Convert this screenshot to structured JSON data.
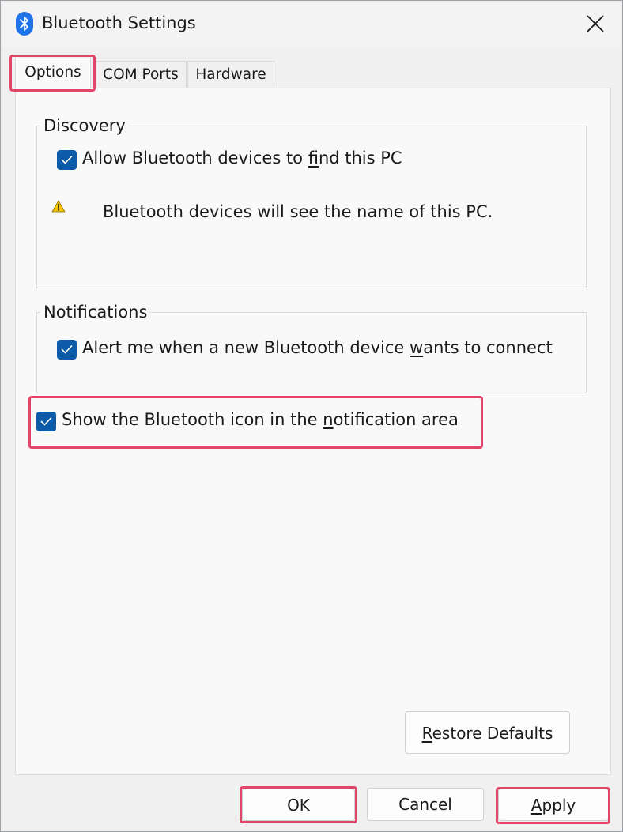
{
  "window": {
    "title": "Bluetooth Settings",
    "icon": "bluetooth-icon"
  },
  "tabs": [
    {
      "label": "Options",
      "selected": true
    },
    {
      "label": "COM Ports",
      "selected": false
    },
    {
      "label": "Hardware",
      "selected": false
    }
  ],
  "discovery": {
    "legend": "Discovery",
    "allow_find": {
      "label_pre": "Allow Bluetooth devices to ",
      "label_key": "f",
      "label_post": "ind this PC",
      "checked": true
    },
    "warning_icon": "warning-icon",
    "warning_text": "Bluetooth devices will see the name of this PC."
  },
  "notifications": {
    "legend": "Notifications",
    "alert_new": {
      "label_pre": "Alert me when a new Bluetooth device ",
      "label_key": "w",
      "label_post": "ants to connect",
      "checked": true
    }
  },
  "show_icon": {
    "label_pre": "Show the Bluetooth icon in the ",
    "label_key": "n",
    "label_post": "otification area",
    "checked": true
  },
  "buttons": {
    "restore_pre": "",
    "restore_key": "R",
    "restore_post": "estore Defaults",
    "ok": "OK",
    "cancel": "Cancel",
    "apply_key": "A",
    "apply_post": "pply"
  },
  "colors": {
    "checkbox": "#0c5ba8",
    "highlight": "#e0466a",
    "bluetooth": "#1e73e8",
    "warning": "#f2c500"
  }
}
